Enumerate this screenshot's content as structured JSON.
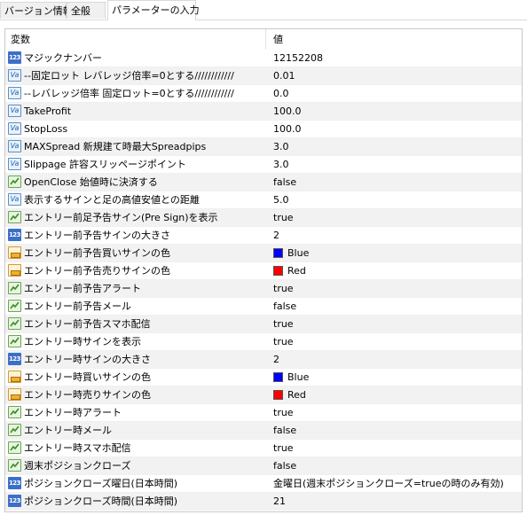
{
  "tabs": [
    {
      "label": "バージョン情報",
      "active": false
    },
    {
      "label": "全般",
      "active": false
    },
    {
      "label": "パラメーターの入力",
      "active": true
    }
  ],
  "table": {
    "header": {
      "name": "変数",
      "value": "値"
    },
    "rows": [
      {
        "type": "int",
        "icon": "integer-icon",
        "name": "マジックナンバー",
        "value": "12152208"
      },
      {
        "type": "dbl",
        "icon": "double-icon",
        "name": "--固定ロット レバレッジ倍率=0とする////////////",
        "value": "0.01"
      },
      {
        "type": "dbl",
        "icon": "double-icon",
        "name": "--レバレッジ倍率 固定ロット=0とする////////////",
        "value": "0.0"
      },
      {
        "type": "dbl",
        "icon": "double-icon",
        "name": "TakeProfit",
        "value": "100.0"
      },
      {
        "type": "dbl",
        "icon": "double-icon",
        "name": "StopLoss",
        "value": "100.0"
      },
      {
        "type": "dbl",
        "icon": "double-icon",
        "name": "MAXSpread 新規建て時最大Spreadpips",
        "value": "3.0"
      },
      {
        "type": "dbl",
        "icon": "double-icon",
        "name": "Slippage 許容スリッページポイント",
        "value": "3.0"
      },
      {
        "type": "bool",
        "icon": "boolean-icon",
        "name": "OpenClose 始値時に決済する",
        "value": "false"
      },
      {
        "type": "dbl",
        "icon": "double-icon",
        "name": "表示するサインと足の高値安値との距離",
        "value": "5.0"
      },
      {
        "type": "bool",
        "icon": "boolean-icon",
        "name": "エントリー前足予告サイン(Pre Sign)を表示",
        "value": "true"
      },
      {
        "type": "int",
        "icon": "integer-icon",
        "name": "エントリー前予告サインの大きさ",
        "value": "2"
      },
      {
        "type": "clr",
        "icon": "color-icon",
        "name": "エントリー前予告買いサインの色",
        "value": "Blue",
        "color": "#0000ff"
      },
      {
        "type": "clr",
        "icon": "color-icon",
        "name": "エントリー前予告売りサインの色",
        "value": "Red",
        "color": "#ff0000"
      },
      {
        "type": "bool",
        "icon": "boolean-icon",
        "name": "エントリー前予告アラート",
        "value": "true"
      },
      {
        "type": "bool",
        "icon": "boolean-icon",
        "name": "エントリー前予告メール",
        "value": "false"
      },
      {
        "type": "bool",
        "icon": "boolean-icon",
        "name": "エントリー前予告スマホ配信",
        "value": "true"
      },
      {
        "type": "bool",
        "icon": "boolean-icon",
        "name": "エントリー時サインを表示",
        "value": "true"
      },
      {
        "type": "int",
        "icon": "integer-icon",
        "name": "エントリー時サインの大きさ",
        "value": "2"
      },
      {
        "type": "clr",
        "icon": "color-icon",
        "name": "エントリー時買いサインの色",
        "value": "Blue",
        "color": "#0000ff"
      },
      {
        "type": "clr",
        "icon": "color-icon",
        "name": "エントリー時売りサインの色",
        "value": "Red",
        "color": "#ff0000"
      },
      {
        "type": "bool",
        "icon": "boolean-icon",
        "name": "エントリー時アラート",
        "value": "true"
      },
      {
        "type": "bool",
        "icon": "boolean-icon",
        "name": "エントリー時メール",
        "value": "false"
      },
      {
        "type": "bool",
        "icon": "boolean-icon",
        "name": "エントリー時スマホ配信",
        "value": "true"
      },
      {
        "type": "bool",
        "icon": "boolean-icon",
        "name": "週末ポジションクローズ",
        "value": "false"
      },
      {
        "type": "int",
        "icon": "integer-icon",
        "name": "ポジションクローズ曜日(日本時間)",
        "value": "金曜日(週末ポジションクローズ=trueの時のみ有効)"
      },
      {
        "type": "int",
        "icon": "integer-icon",
        "name": "ポジションクローズ時間(日本時間)",
        "value": "21"
      }
    ]
  }
}
